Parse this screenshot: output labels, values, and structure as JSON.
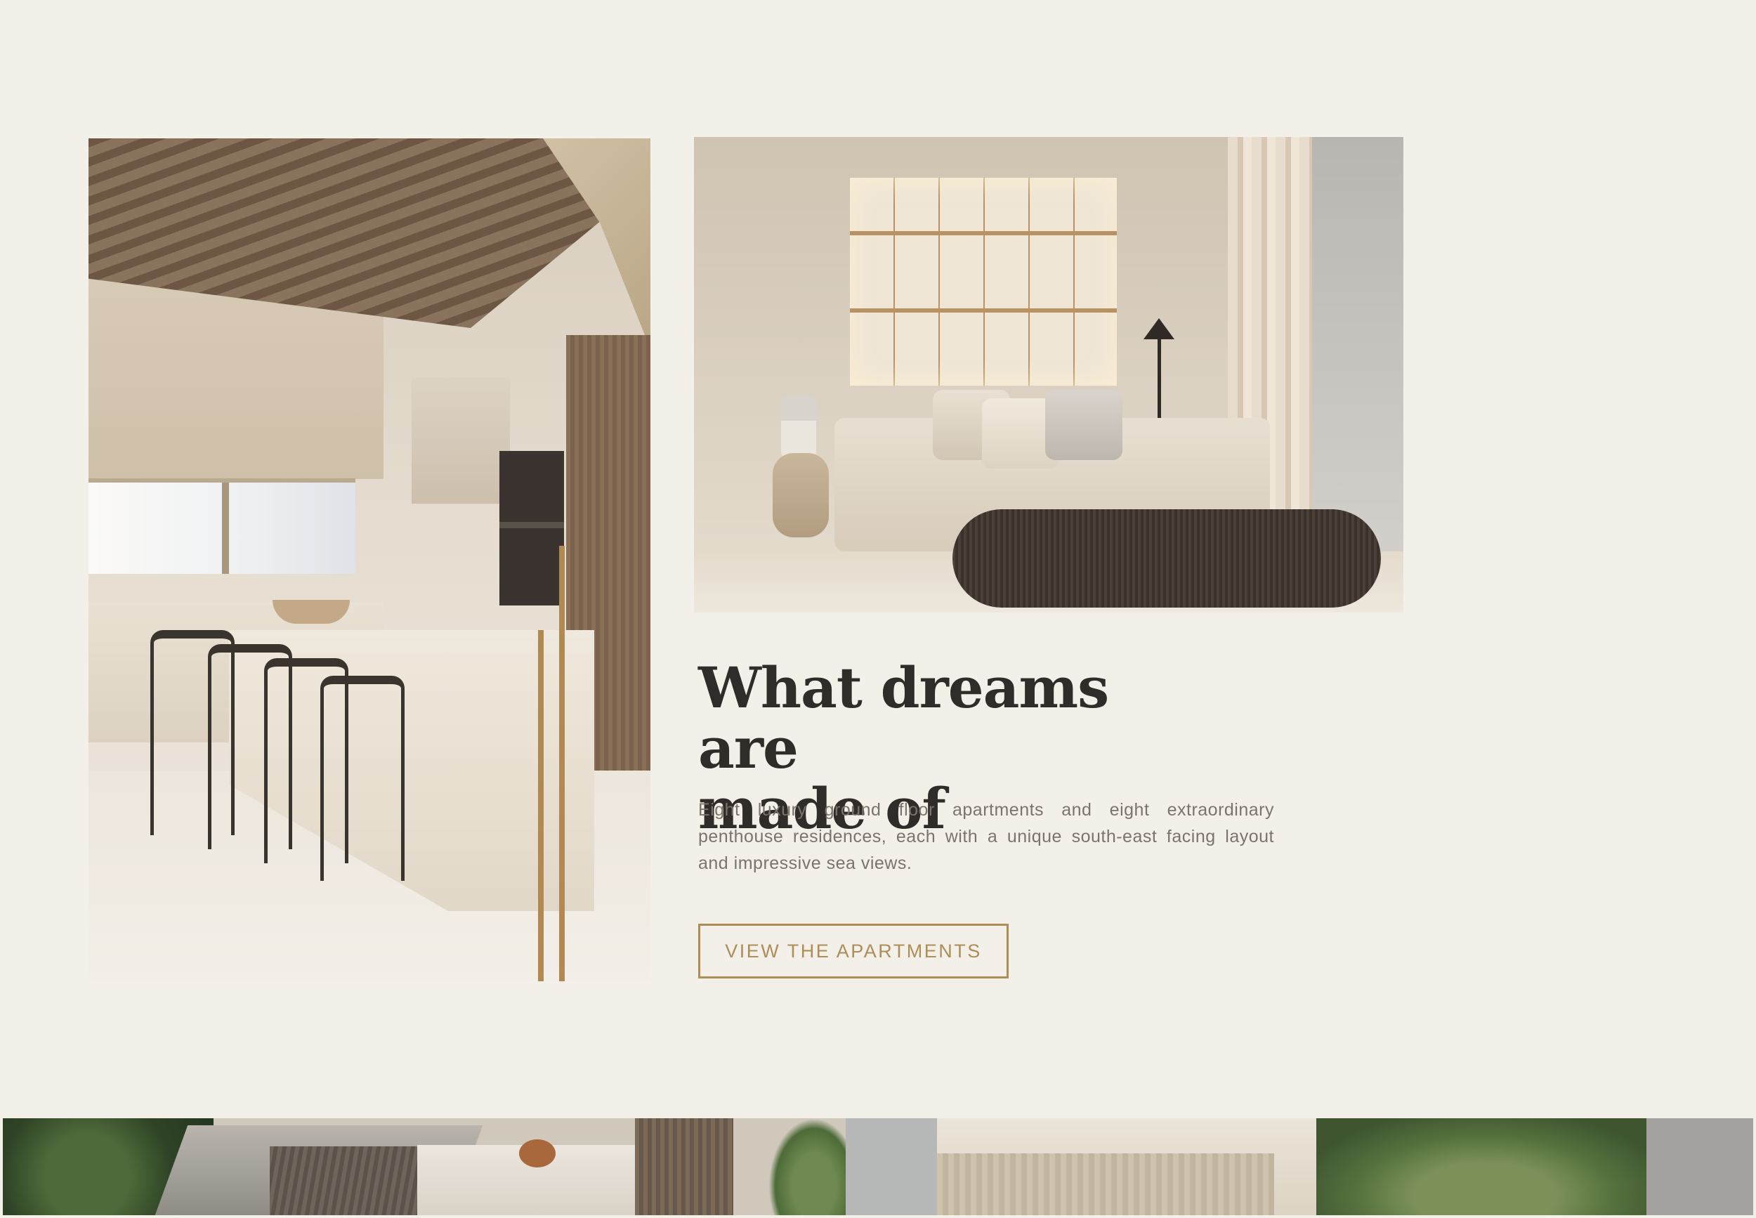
{
  "section": {
    "heading_line1": "What dreams are",
    "heading_line2": "made of",
    "description": "Eight luxury ground floor apartments and eight extraordinary penthouse residences, each with a unique south-east facing layout and impressive sea views.",
    "cta_label": "VIEW THE APARTMENTS"
  },
  "images": {
    "left": "kitchen-interior",
    "right": "living-room-interior",
    "bottom": "terrace-aerial-view"
  },
  "colors": {
    "background": "#f3f0ea",
    "heading": "#2f2c29",
    "body": "#7b746c",
    "accent": "#ad8e57"
  }
}
